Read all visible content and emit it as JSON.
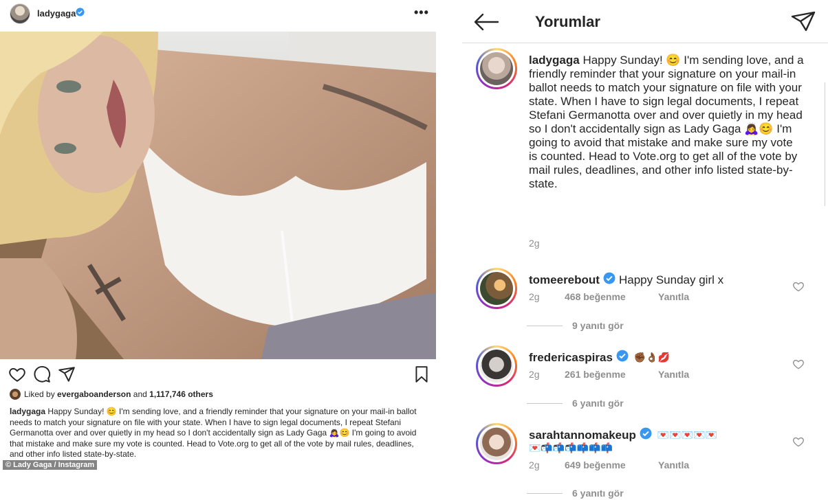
{
  "post": {
    "username": "ladygaga",
    "likes": {
      "prefix": "Liked by",
      "user": "evergaboanderson",
      "joiner": "and",
      "count": "1,117,746 others"
    },
    "caption": {
      "username": "ladygaga",
      "text": "Happy Sunday! 😊 I'm sending love, and a friendly reminder that your signature on your mail-in ballot needs to match your signature on file with your state. When I have to sign legal documents, I repeat Stefani Germanotta over and over quietly in my head so I don't accidentally sign as Lady Gaga 🙇‍♀️😊 I'm going to avoid that mistake and make sure my vote is counted. Head to Vote.org to get all of the vote by mail rules, deadlines, and other info listed state-by-state."
    },
    "credit": "© Lady Gaga / Instagram"
  },
  "comments_panel": {
    "title": "Yorumlar",
    "caption": {
      "username": "ladygaga",
      "text": "Happy Sunday! 😊 I'm sending love, and a friendly reminder that your signature on your mail-in ballot needs to match your signature on file with your state. When I have to sign legal documents, I repeat Stefani Germanotta over and over quietly in my head so I don't accidentally sign as Lady Gaga 🙇‍♀️😊 I'm going to avoid that mistake and make sure my vote is counted. Head to Vote.org to get all of the vote by mail rules, deadlines, and other info listed state-by-state.",
      "time": "2g"
    },
    "comments": [
      {
        "username": "tomeerebout",
        "text": "Happy Sunday girl x",
        "time": "2g",
        "likes": "468 beğenme",
        "reply": "Yanıtla",
        "replies": "9 yanıtı gör"
      },
      {
        "username": "fredericaspiras",
        "text": "✊🏾👌🏾💋",
        "time": "2g",
        "likes": "261 beğenme",
        "reply": "Yanıtla",
        "replies": "6 yanıtı gör"
      },
      {
        "username": "sarahtannomakeup",
        "text": "💌💌💌💌💌",
        "text2": "💌📬📬📬📫📫📫",
        "time": "2g",
        "likes": "649 beğenme",
        "reply": "Yanıtla",
        "replies": "6 yanıtı gör"
      }
    ]
  },
  "colors": {
    "verified": "#3897f0",
    "text": "#262626",
    "muted": "#8e8e8e"
  },
  "icons": [
    "verified-badge-icon",
    "more-icon",
    "heart-icon",
    "comment-icon",
    "share-icon",
    "bookmark-icon",
    "back-arrow-icon",
    "send-icon"
  ]
}
